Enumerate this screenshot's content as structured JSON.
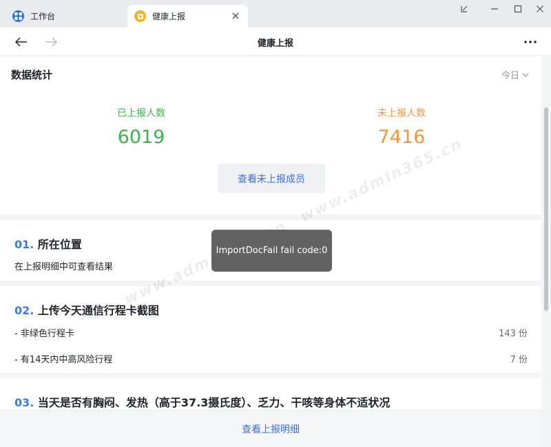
{
  "tabs": [
    {
      "label": "工作台"
    },
    {
      "label": "健康上报"
    }
  ],
  "nav": {
    "title": "健康上报"
  },
  "stats": {
    "title": "数据统计",
    "date_filter": "今日",
    "reported_label": "已上报人数",
    "reported_value": "6019",
    "unreported_label": "未上报人数",
    "unreported_value": "7416",
    "view_unreported_button": "查看未上报成员"
  },
  "questions": [
    {
      "num": "01.",
      "title": "所在位置",
      "note": "在上报明细中可查看结果"
    },
    {
      "num": "02.",
      "title": "上传今天通信行程卡截图",
      "rows": [
        {
          "label": "- 非绿色行程卡",
          "count": "143 份"
        },
        {
          "label": "- 有14天内中高风险行程",
          "count": "7 份"
        }
      ]
    },
    {
      "num": "03.",
      "title": "当天是否有胸闷、发热（高于37.3摄氏度）、乏力、干咳等身体不适状况"
    }
  ],
  "bottom": {
    "view_details_label": "查看上报明细"
  },
  "toast": {
    "message": "ImportDocFail fail code:0"
  },
  "watermark": {
    "text": "www.admin365.cn"
  },
  "colors": {
    "reported": "#3bb54a",
    "unreported": "#ef9a3c",
    "link": "#3370ff",
    "question_number": "#3b7ddc"
  }
}
